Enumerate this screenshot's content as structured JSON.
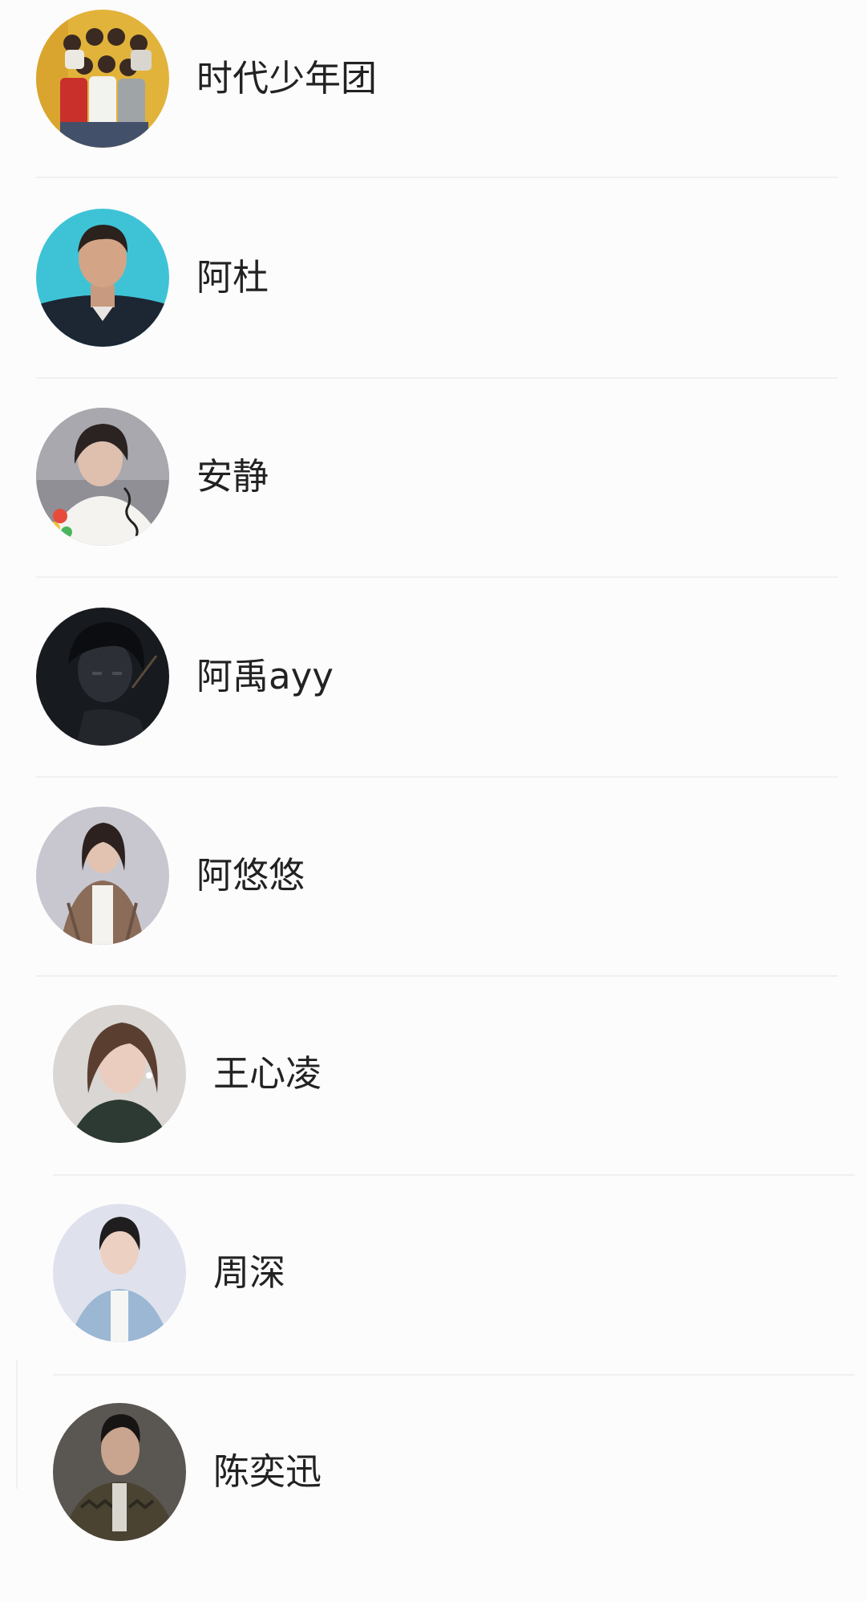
{
  "artists": [
    {
      "name": "时代少年团",
      "avatar_icon": "group-photo-avatar"
    },
    {
      "name": "阿杜",
      "avatar_icon": "male-portrait-avatar"
    },
    {
      "name": "安静",
      "avatar_icon": "female-portrait-avatar"
    },
    {
      "name": "阿禹ayy",
      "avatar_icon": "anime-portrait-avatar"
    },
    {
      "name": "阿悠悠",
      "avatar_icon": "female-portrait-avatar"
    },
    {
      "name": "王心凌",
      "avatar_icon": "female-portrait-avatar"
    },
    {
      "name": "周深",
      "avatar_icon": "male-portrait-avatar"
    },
    {
      "name": "陈奕迅",
      "avatar_icon": "male-portrait-avatar"
    }
  ],
  "colors": {
    "background": "#fdfcfd",
    "text": "#222222",
    "divider": "#f0eff1"
  }
}
